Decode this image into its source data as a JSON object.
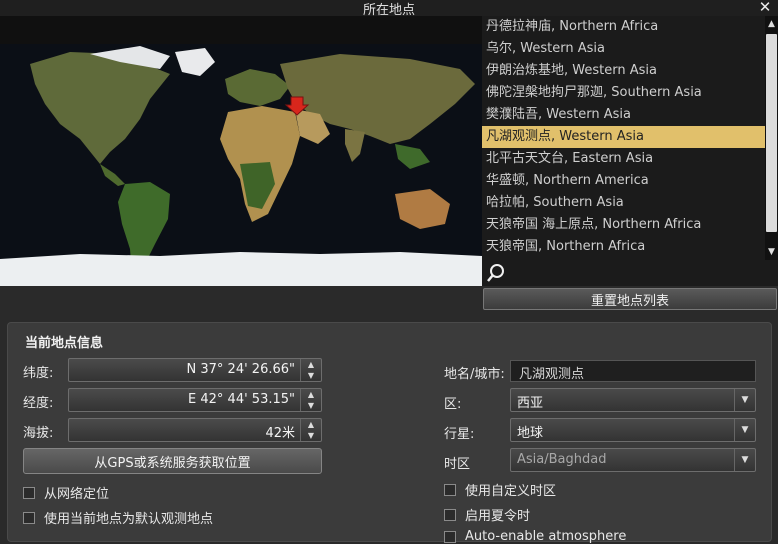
{
  "window": {
    "title": "所在地点",
    "close_icon": "close-icon"
  },
  "locations": [
    {
      "label": "丹德拉神庙, Northern Africa",
      "selected": false
    },
    {
      "label": "乌尔, Western Asia",
      "selected": false
    },
    {
      "label": "伊朗治炼基地, Western Asia",
      "selected": false
    },
    {
      "label": "佛陀涅槃地拘尸那迦, Southern Asia",
      "selected": false
    },
    {
      "label": "樊濮陆吾, Western Asia",
      "selected": false
    },
    {
      "label": "凡湖观测点, Western Asia",
      "selected": true
    },
    {
      "label": "北平古天文台, Eastern Asia",
      "selected": false
    },
    {
      "label": "华盛顿, Northern America",
      "selected": false
    },
    {
      "label": "哈拉帕, Southern Asia",
      "selected": false
    },
    {
      "label": "天狼帝国 海上原点, Northern Africa",
      "selected": false
    },
    {
      "label": "天狼帝国, Northern Africa",
      "selected": false
    }
  ],
  "search": {
    "icon": "search-icon",
    "value": ""
  },
  "reset_button": "重置地点列表",
  "panel": {
    "title": "当前地点信息",
    "latitude": {
      "label": "纬度:",
      "value": "N 37° 24' 26.66\""
    },
    "longitude": {
      "label": "经度:",
      "value": "E 42° 44' 53.15\""
    },
    "altitude": {
      "label": "海拔:",
      "value": "42米"
    },
    "gps_button": "从GPS或系统服务获取位置",
    "checks": {
      "network": "从网络定位",
      "default": "使用当前地点为默认观测地点",
      "custom_tz": "使用自定义时区",
      "dst": "启用夏令时",
      "atmosphere": "Auto-enable atmosphere"
    },
    "name": {
      "label": "地名/城市:",
      "value": "凡湖观测点"
    },
    "region": {
      "label": "区:",
      "value": "西亚"
    },
    "planet": {
      "label": "行星:",
      "value": "地球"
    },
    "timezone": {
      "label": "时区",
      "value": "Asia/Baghdad"
    }
  },
  "colors": {
    "selection": "#e1c06b",
    "marker": "#d8261c"
  }
}
